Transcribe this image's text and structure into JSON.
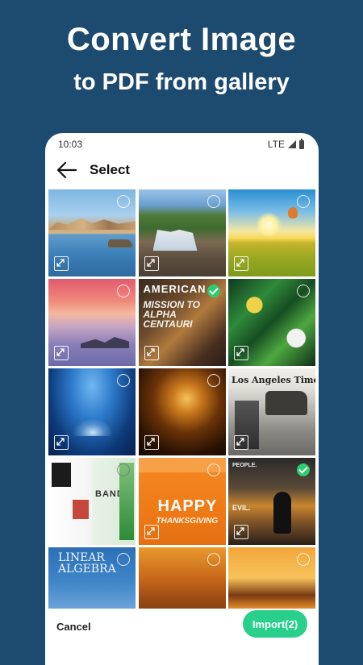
{
  "promo": {
    "line1": "Convert Image",
    "line2": "to PDF from gallery"
  },
  "status": {
    "time": "10:03",
    "network": "LTE"
  },
  "toolbar": {
    "title": "Select"
  },
  "tiles": [
    {
      "name": "lake-mountains",
      "selected": false
    },
    {
      "name": "waterfall-rocks",
      "selected": false
    },
    {
      "name": "sunny-field",
      "selected": false
    },
    {
      "name": "pink-sunset-sea",
      "selected": false
    },
    {
      "name": "magazine-alpha-centauri",
      "selected": true,
      "text_top": "AMERICAN",
      "text_main": "MISSION TO\nALPHA\nCENTAURI"
    },
    {
      "name": "tropical-leaves-flowers",
      "selected": false
    },
    {
      "name": "water-splash",
      "selected": false
    },
    {
      "name": "golden-sparkles",
      "selected": false
    },
    {
      "name": "los-angeles-times",
      "selected": false,
      "text_top": "Los Angeles Times"
    },
    {
      "name": "magazine-spread",
      "selected": false,
      "text_top": "BANDA"
    },
    {
      "name": "happy-thanksgiving",
      "selected": false,
      "text_top": "HAPPY",
      "text_main": "THANKSGIVING"
    },
    {
      "name": "evil-street-silhouette",
      "selected": true,
      "text_top": "PEOPLE.",
      "text_main": "EVIL."
    },
    {
      "name": "linear-algebra-book",
      "selected": false,
      "text_top": "LINEAR\nALGEBRA"
    },
    {
      "name": "autumn-forest",
      "selected": false
    },
    {
      "name": "sunset-reflection",
      "selected": false
    }
  ],
  "actions": {
    "cancel_label": "Cancel",
    "import_label": "Import(2)"
  },
  "colors": {
    "background": "#1d4a6f",
    "accent": "#28d08b",
    "check": "#2ecc71"
  }
}
